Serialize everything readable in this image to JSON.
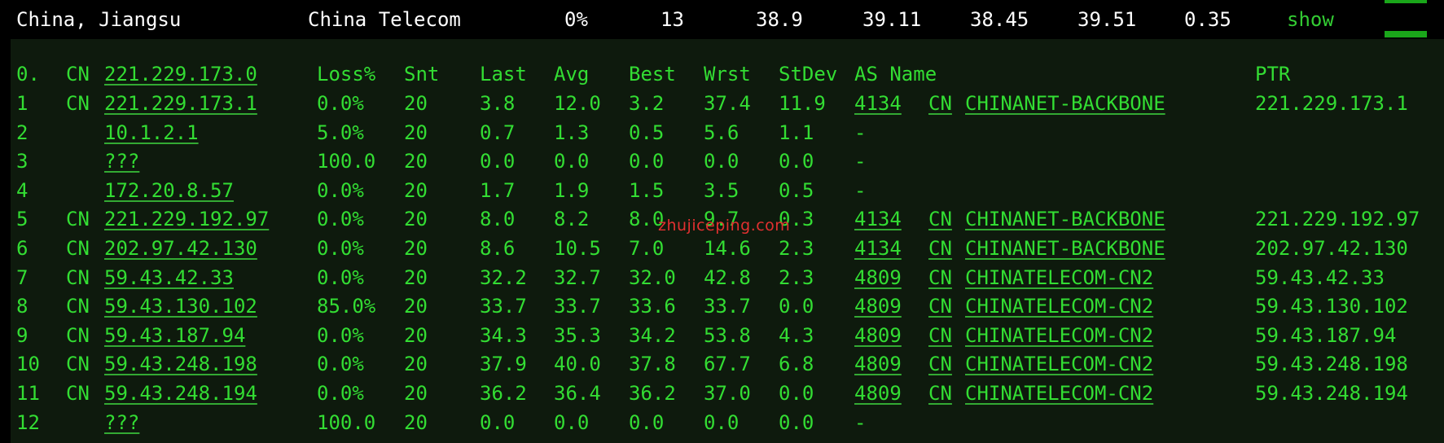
{
  "summary": {
    "location": "China, Jiangsu",
    "isp": "China Telecom",
    "loss": "0%",
    "hops": "13",
    "last": "38.9",
    "avg": "39.11",
    "best": "38.45",
    "worst": "39.51",
    "stdev": "0.35",
    "show_label": "show"
  },
  "header": {
    "index": "0.",
    "cc": "CN",
    "host": "221.229.173.0",
    "loss": "Loss%",
    "snt": "Snt",
    "last": "Last",
    "avg": "Avg",
    "best": "Best",
    "wrst": "Wrst",
    "stdev": "StDev",
    "as_name": "AS Name",
    "ptr": "PTR"
  },
  "hops": [
    {
      "n": "1",
      "cc": "CN",
      "host": "221.229.173.1",
      "loss": "0.0%",
      "snt": "20",
      "last": "3.8",
      "avg": "12.0",
      "best": "3.2",
      "wrst": "37.4",
      "stdev": "11.9",
      "asn": "4134",
      "as_cc": "CN",
      "as_name": "CHINANET-BACKBONE",
      "ptr": "221.229.173.1"
    },
    {
      "n": "2",
      "cc": "",
      "host": "10.1.2.1",
      "loss": "5.0%",
      "snt": "20",
      "last": "0.7",
      "avg": "1.3",
      "best": "0.5",
      "wrst": "5.6",
      "stdev": "1.1",
      "asn": "-",
      "as_cc": "",
      "as_name": "",
      "ptr": ""
    },
    {
      "n": "3",
      "cc": "",
      "host": "???",
      "loss": "100.0",
      "snt": "20",
      "last": "0.0",
      "avg": "0.0",
      "best": "0.0",
      "wrst": "0.0",
      "stdev": "0.0",
      "asn": "-",
      "as_cc": "",
      "as_name": "",
      "ptr": ""
    },
    {
      "n": "4",
      "cc": "",
      "host": "172.20.8.57",
      "loss": "0.0%",
      "snt": "20",
      "last": "1.7",
      "avg": "1.9",
      "best": "1.5",
      "wrst": "3.5",
      "stdev": "0.5",
      "asn": "-",
      "as_cc": "",
      "as_name": "",
      "ptr": ""
    },
    {
      "n": "5",
      "cc": "CN",
      "host": "221.229.192.97",
      "loss": "0.0%",
      "snt": "20",
      "last": "8.0",
      "avg": "8.2",
      "best": "8.0",
      "wrst": "9.7",
      "stdev": "0.3",
      "asn": "4134",
      "as_cc": "CN",
      "as_name": "CHINANET-BACKBONE",
      "ptr": "221.229.192.97"
    },
    {
      "n": "6",
      "cc": "CN",
      "host": "202.97.42.130",
      "loss": "0.0%",
      "snt": "20",
      "last": "8.6",
      "avg": "10.5",
      "best": "7.0",
      "wrst": "14.6",
      "stdev": "2.3",
      "asn": "4134",
      "as_cc": "CN",
      "as_name": "CHINANET-BACKBONE",
      "ptr": "202.97.42.130"
    },
    {
      "n": "7",
      "cc": "CN",
      "host": "59.43.42.33",
      "loss": "0.0%",
      "snt": "20",
      "last": "32.2",
      "avg": "32.7",
      "best": "32.0",
      "wrst": "42.8",
      "stdev": "2.3",
      "asn": "4809",
      "as_cc": "CN",
      "as_name": "CHINATELECOM-CN2",
      "ptr": "59.43.42.33"
    },
    {
      "n": "8",
      "cc": "CN",
      "host": "59.43.130.102",
      "loss": "85.0%",
      "snt": "20",
      "last": "33.7",
      "avg": "33.7",
      "best": "33.6",
      "wrst": "33.7",
      "stdev": "0.0",
      "asn": "4809",
      "as_cc": "CN",
      "as_name": "CHINATELECOM-CN2",
      "ptr": "59.43.130.102"
    },
    {
      "n": "9",
      "cc": "CN",
      "host": "59.43.187.94",
      "loss": "0.0%",
      "snt": "20",
      "last": "34.3",
      "avg": "35.3",
      "best": "34.2",
      "wrst": "53.8",
      "stdev": "4.3",
      "asn": "4809",
      "as_cc": "CN",
      "as_name": "CHINATELECOM-CN2",
      "ptr": "59.43.187.94"
    },
    {
      "n": "10",
      "cc": "CN",
      "host": "59.43.248.198",
      "loss": "0.0%",
      "snt": "20",
      "last": "37.9",
      "avg": "40.0",
      "best": "37.8",
      "wrst": "67.7",
      "stdev": "6.8",
      "asn": "4809",
      "as_cc": "CN",
      "as_name": "CHINATELECOM-CN2",
      "ptr": "59.43.248.198"
    },
    {
      "n": "11",
      "cc": "CN",
      "host": "59.43.248.194",
      "loss": "0.0%",
      "snt": "20",
      "last": "36.2",
      "avg": "36.4",
      "best": "36.2",
      "wrst": "37.0",
      "stdev": "0.0",
      "asn": "4809",
      "as_cc": "CN",
      "as_name": "CHINATELECOM-CN2",
      "ptr": "59.43.248.194"
    },
    {
      "n": "12",
      "cc": "",
      "host": "???",
      "loss": "100.0",
      "snt": "20",
      "last": "0.0",
      "avg": "0.0",
      "best": "0.0",
      "wrst": "0.0",
      "stdev": "0.0",
      "asn": "-",
      "as_cc": "",
      "as_name": "",
      "ptr": ""
    }
  ],
  "watermark": "zhujiceping.com",
  "colors": {
    "background": "#000000",
    "panel": "#0e1a0d",
    "text_green": "#33dd33",
    "summary_text": "#ffffff",
    "watermark": "#e23030"
  }
}
